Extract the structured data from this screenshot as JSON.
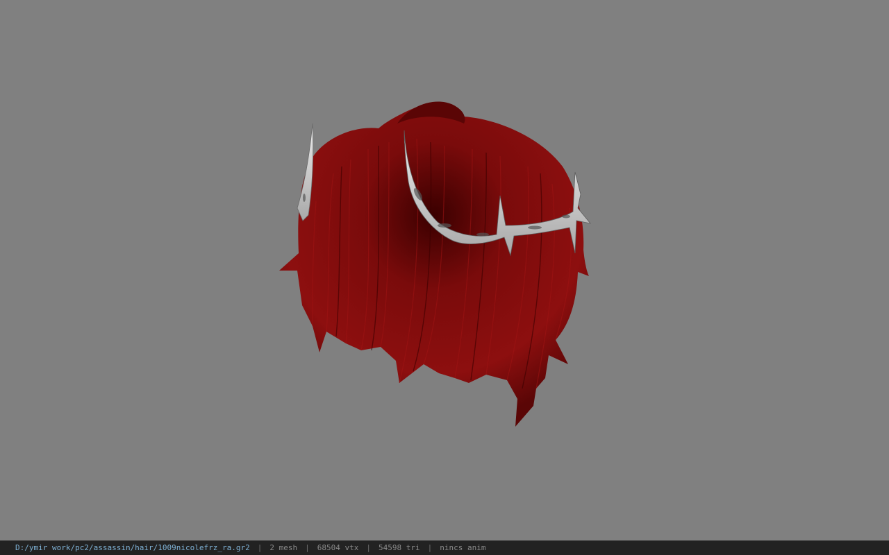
{
  "viewport": {
    "background_color": "#808080",
    "model": {
      "hair_color": "#7a0b0b",
      "hair_dark": "#2a0000",
      "hair_highlight": "#b01818",
      "ornament_color": "#d8d8d8"
    }
  },
  "statusbar": {
    "file_path": "D:/ymir work/pc2/assassin/hair/1009nicolefrz_ra.gr2",
    "separator": "|",
    "mesh": "2 mesh",
    "vertices": "68504 vtx",
    "triangles": "54598 tri",
    "animation": "nincs anim",
    "path_color": "#7fb2d6",
    "text_color": "#8a8a8a"
  }
}
